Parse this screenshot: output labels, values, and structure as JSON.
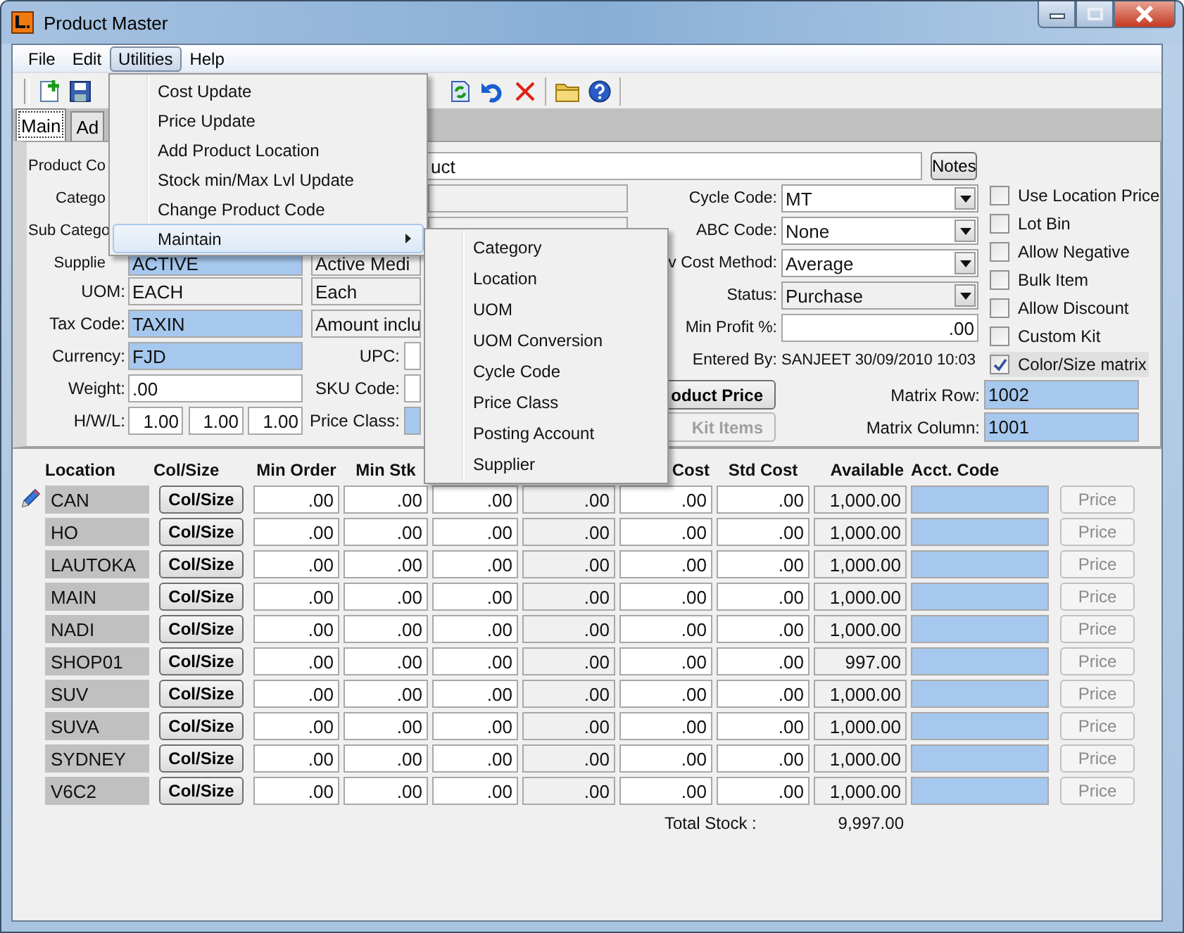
{
  "window": {
    "title": "Product Master"
  },
  "menu_bar": [
    {
      "label": "File",
      "selected": false
    },
    {
      "label": "Edit",
      "selected": false
    },
    {
      "label": "Utilities",
      "selected": true
    },
    {
      "label": "Help",
      "selected": false
    }
  ],
  "utilities_menu": [
    {
      "label": "Cost Update",
      "highlighted": false,
      "has_submenu": false
    },
    {
      "label": "Price Update",
      "highlighted": false,
      "has_submenu": false
    },
    {
      "label": "Add Product Location",
      "highlighted": false,
      "has_submenu": false
    },
    {
      "label": "Stock min/Max Lvl Update",
      "highlighted": false,
      "has_submenu": false
    },
    {
      "label": "Change Product Code",
      "highlighted": false,
      "has_submenu": false
    },
    {
      "label": "Maintain",
      "highlighted": true,
      "has_submenu": true
    }
  ],
  "maintain_submenu": [
    "Category",
    "Location",
    "UOM",
    "UOM Conversion",
    "Cycle Code",
    "Price Class",
    "Posting Account",
    "Supplier"
  ],
  "tabs": [
    {
      "label": "Main",
      "selected": true
    },
    {
      "label": "Ad",
      "selected": false
    }
  ],
  "product_code": {
    "label": "Product Co",
    "value": "uct"
  },
  "notes_button": "Notes",
  "left_rows": [
    {
      "label": "Catego",
      "middle": {
        "kind": "readonly"
      }
    },
    {
      "label": "Sub Catego",
      "middle": {
        "kind": "readonly"
      }
    },
    {
      "label": "Supplie",
      "field": {
        "kind": "lookup",
        "value": "ACTIVE"
      },
      "middle": {
        "kind": "readonly",
        "value": "Active Medi"
      }
    },
    {
      "label": "UOM:",
      "field": {
        "kind": "readonly",
        "value": "EACH"
      },
      "middle": {
        "kind": "readonly",
        "value": "Each"
      }
    },
    {
      "label": "Tax Code:",
      "field": {
        "kind": "lookup",
        "value": "TAXIN"
      },
      "middle": {
        "kind": "readonly",
        "value": "Amount inclu"
      }
    },
    {
      "label": "Currency:",
      "field": {
        "kind": "lookup",
        "value": "FJD"
      },
      "middle_label": "UPC:",
      "middle": {
        "kind": "input"
      }
    },
    {
      "label": "Weight:",
      "field": {
        "kind": "input",
        "value": ".00"
      },
      "middle_label": "SKU Code:",
      "middle": {
        "kind": "input"
      }
    },
    {
      "label": "H/W/L:",
      "triple": [
        "1.00",
        "1.00",
        "1.00"
      ],
      "middle_label": "Price Class:",
      "middle": {
        "kind": "lookup"
      }
    }
  ],
  "right_rows": [
    {
      "kind": "dropdown",
      "label": "Cycle Code:",
      "value": "MT",
      "disabled": false
    },
    {
      "kind": "dropdown",
      "label": "ABC Code:",
      "value": "None",
      "disabled": false
    },
    {
      "kind": "dropdown",
      "label": "v Cost Method:",
      "value": "Average",
      "disabled": false
    },
    {
      "kind": "dropdown",
      "label": "Status:",
      "value": "Purchase",
      "disabled": true
    },
    {
      "kind": "input",
      "label": "Min Profit %:",
      "value": ".00"
    },
    {
      "kind": "text",
      "label": "Entered By:",
      "value": "SANJEET 30/09/2010 10:03"
    }
  ],
  "checkboxes": [
    {
      "label": "Use Location Price",
      "checked": false,
      "focused": false
    },
    {
      "label": "Lot Bin",
      "checked": false,
      "focused": false
    },
    {
      "label": "Allow Negative",
      "checked": false,
      "focused": false
    },
    {
      "label": "Bulk Item",
      "checked": false,
      "focused": false
    },
    {
      "label": "Allow Discount",
      "checked": false,
      "focused": false
    },
    {
      "label": "Custom Kit",
      "checked": false,
      "focused": false
    },
    {
      "label": "Color/Size matrix",
      "checked": true,
      "focused": true
    }
  ],
  "action_buttons": [
    {
      "label": "oduct Price",
      "disabled": false
    },
    {
      "label": "Kit Items",
      "disabled": true
    }
  ],
  "matrix_fields": [
    {
      "label": "Matrix Row:",
      "value": "1002"
    },
    {
      "label": "Matrix Column:",
      "value": "1001"
    }
  ],
  "grid": {
    "headers": {
      "location": "Location",
      "col_size": "Col/Size",
      "min_order": "Min Order",
      "min_stk": "Min Stk",
      "cost": "Cost",
      "std_cost": "Std Cost",
      "available": "Available",
      "acct_code": "Acct. Code"
    },
    "rows": [
      {
        "editing": true,
        "location": "CAN",
        "col_size": "Col/Size",
        "min_order": ".00",
        "min_stk": ".00",
        "column_5": ".00",
        "column_6": ".00",
        "cost": ".00",
        "std_cost": ".00",
        "available": "1,000.00",
        "price": "Price",
        "price_disabled": true
      },
      {
        "editing": false,
        "location": "HO",
        "col_size": "Col/Size",
        "min_order": ".00",
        "min_stk": ".00",
        "column_5": ".00",
        "column_6": ".00",
        "cost": ".00",
        "std_cost": ".00",
        "available": "1,000.00",
        "price": "Price",
        "price_disabled": true
      },
      {
        "editing": false,
        "location": "LAUTOKA",
        "col_size": "Col/Size",
        "min_order": ".00",
        "min_stk": ".00",
        "column_5": ".00",
        "column_6": ".00",
        "cost": ".00",
        "std_cost": ".00",
        "available": "1,000.00",
        "price": "Price",
        "price_disabled": true
      },
      {
        "editing": false,
        "location": "MAIN",
        "col_size": "Col/Size",
        "min_order": ".00",
        "min_stk": ".00",
        "column_5": ".00",
        "column_6": ".00",
        "cost": ".00",
        "std_cost": ".00",
        "available": "1,000.00",
        "price": "Price",
        "price_disabled": true
      },
      {
        "editing": false,
        "location": "NADI",
        "col_size": "Col/Size",
        "min_order": ".00",
        "min_stk": ".00",
        "column_5": ".00",
        "column_6": ".00",
        "cost": ".00",
        "std_cost": ".00",
        "available": "1,000.00",
        "price": "Price",
        "price_disabled": true
      },
      {
        "editing": false,
        "location": "SHOP01",
        "col_size": "Col/Size",
        "min_order": ".00",
        "min_stk": ".00",
        "column_5": ".00",
        "column_6": ".00",
        "cost": ".00",
        "std_cost": ".00",
        "available": "997.00",
        "price": "Price",
        "price_disabled": true
      },
      {
        "editing": false,
        "location": "SUV",
        "col_size": "Col/Size",
        "min_order": ".00",
        "min_stk": ".00",
        "column_5": ".00",
        "column_6": ".00",
        "cost": ".00",
        "std_cost": ".00",
        "available": "1,000.00",
        "price": "Price",
        "price_disabled": true
      },
      {
        "editing": false,
        "location": "SUVA",
        "col_size": "Col/Size",
        "min_order": ".00",
        "min_stk": ".00",
        "column_5": ".00",
        "column_6": ".00",
        "cost": ".00",
        "std_cost": ".00",
        "available": "1,000.00",
        "price": "Price",
        "price_disabled": true
      },
      {
        "editing": false,
        "location": "SYDNEY",
        "col_size": "Col/Size",
        "min_order": ".00",
        "min_stk": ".00",
        "column_5": ".00",
        "column_6": ".00",
        "cost": ".00",
        "std_cost": ".00",
        "available": "1,000.00",
        "price": "Price",
        "price_disabled": true
      },
      {
        "editing": false,
        "location": "V6C2",
        "col_size": "Col/Size",
        "min_order": ".00",
        "min_stk": ".00",
        "column_5": ".00",
        "column_6": ".00",
        "cost": ".00",
        "std_cost": ".00",
        "available": "1,000.00",
        "price": "Price",
        "price_disabled": true
      }
    ]
  },
  "total_stock": {
    "label": "Total Stock :",
    "value": "9,997.00"
  }
}
